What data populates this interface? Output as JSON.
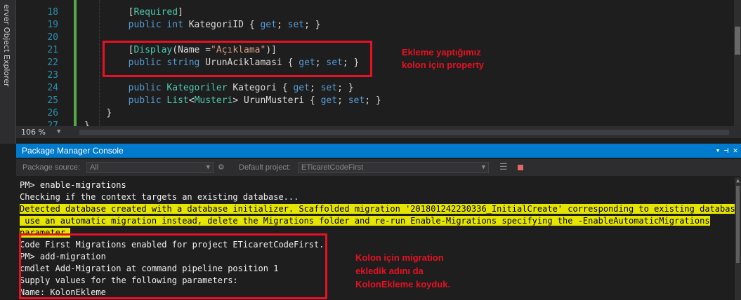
{
  "sidebar": {
    "label": "erver Object Explorer"
  },
  "editor": {
    "line_numbers": [
      "18",
      "19",
      "20",
      "21",
      "22",
      "23",
      "24",
      "25",
      "26",
      "27"
    ],
    "code": {
      "l18": {
        "a": "[",
        "b": "Required",
        "c": "]"
      },
      "l19": {
        "a": "public",
        "b": "int",
        "c": " KategoriID { ",
        "d": "get",
        "e": "; ",
        "f": "set",
        "g": "; }"
      },
      "l21": {
        "a": "[",
        "b": "Display",
        "c": "(Name =",
        "d": "\"Açıklama\"",
        "e": ")]"
      },
      "l22": {
        "a": "public",
        "b": "string",
        "c": " UrunAciklamasi { ",
        "d": "get",
        "e": "; ",
        "f": "set",
        "g": "; }"
      },
      "l24": {
        "a": "public",
        "b": "Kategoriler",
        "c": " Kategori { ",
        "d": "get",
        "e": "; ",
        "f": "set",
        "g": "; }"
      },
      "l25": {
        "a": "public",
        "b": "List",
        "c": "<",
        "d": "Musteri",
        "e": "> UrunMusteri { ",
        "f": "get",
        "g": "; ",
        "h": "set",
        "i": "; }"
      },
      "l26": "}",
      "l27": "}"
    }
  },
  "annotations": {
    "top": "Ekleme yaptığımız\nkolon için property",
    "bottom": "Kolon için migration\nekledik adını da\nKolonEkleme koyduk."
  },
  "status": {
    "zoom": "106 %"
  },
  "panel": {
    "title": "Package Manager Console",
    "package_source_label": "Package source:",
    "package_source_value": "All",
    "default_project_label": "Default project:",
    "default_project_value": "ETicaretCodeFirst",
    "console_lines": {
      "l1": "PM> enable-migrations",
      "l2": "Checking if the context targets an existing database...",
      "l3": "Detected database created with a database initializer. Scaffolded migration '201801242230336_InitialCreate' corresponding to existing database. To",
      "l4": " use an automatic migration instead, delete the Migrations folder and re-run Enable-Migrations specifying the -EnableAutomaticMigrations",
      "l5": "parameter.",
      "l6": "Code First Migrations enabled for project ETicaretCodeFirst.",
      "l7": "PM> add-migration",
      "l8": "cmdlet Add-Migration at command pipeline position 1",
      "l9": "Supply values for the following parameters:",
      "l10": "Name: KolonEkleme"
    }
  },
  "colors": {
    "accent": "#007acc",
    "annotation": "#e81123",
    "highlight": "#e5e500"
  }
}
